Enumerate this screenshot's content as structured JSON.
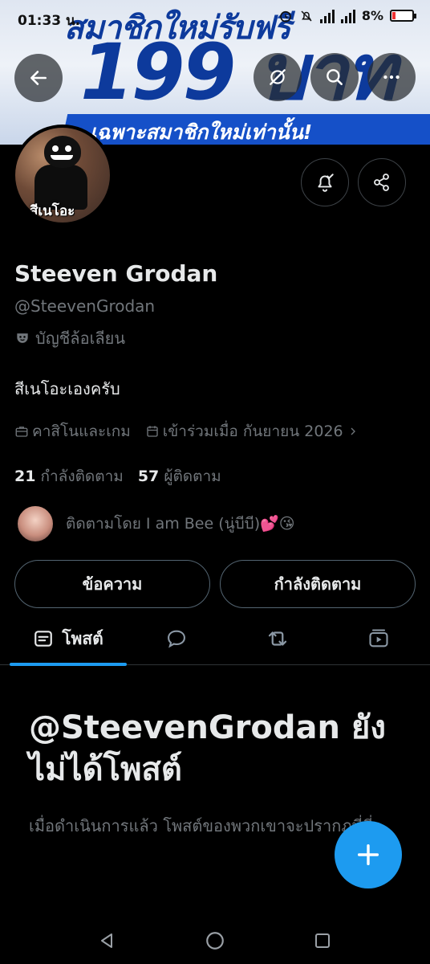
{
  "banner": {
    "line1": "สมาชิกใหม่รับฟรี",
    "price": "199 บาท",
    "strip": "เฉพาะสมาชิกใหม่เท่านั้น!"
  },
  "status_bar": {
    "time": "01:33",
    "suffix": "น.",
    "battery_pct": "8%",
    "battery_level": 0.08
  },
  "profile": {
    "avatar_caption": "สีเนโอะ",
    "name": "Steeven Grodan",
    "handle": "@SteevenGrodan",
    "parody_label": "บัญชีล้อเลียน",
    "bio": "สีเนโอะเองครับ",
    "category": "คาสิโนและเกม",
    "joined": "เข้าร่วมเมื่อ กันยายน 2026",
    "following_count": "21",
    "following_label": "กำลังติดตาม",
    "followers_count": "57",
    "followers_label": "ผู้ติดตาม",
    "followed_by": "ติดตามโดย I am Bee (นู่บีบี)💕😘"
  },
  "actions": {
    "message": "ข้อความ",
    "following": "กำลังติดตาม"
  },
  "tabs": {
    "posts": "โพสต์"
  },
  "empty_state": {
    "title": "@SteevenGrodan ยังไม่ได้โพสต์",
    "subtitle": "เมื่อดำเนินการแล้ว โพสต์ของพวกเขาจะปรากฏที่นี่"
  },
  "colors": {
    "accent": "#1d9bf0",
    "background": "#000000",
    "text_primary": "#e7e9ea",
    "text_secondary": "#71767b"
  },
  "icons": {
    "back": "arrow-left-icon",
    "grok": "grok-icon",
    "search": "search-icon",
    "more": "more-horizontal-icon",
    "notify": "bell-check-icon",
    "share": "share-icon",
    "parody": "mask-icon",
    "category": "briefcase-icon",
    "calendar": "calendar-icon",
    "posts": "posts-icon",
    "replies": "comment-icon",
    "reposts": "repost-icon",
    "media": "media-icon",
    "compose": "plus-icon"
  }
}
